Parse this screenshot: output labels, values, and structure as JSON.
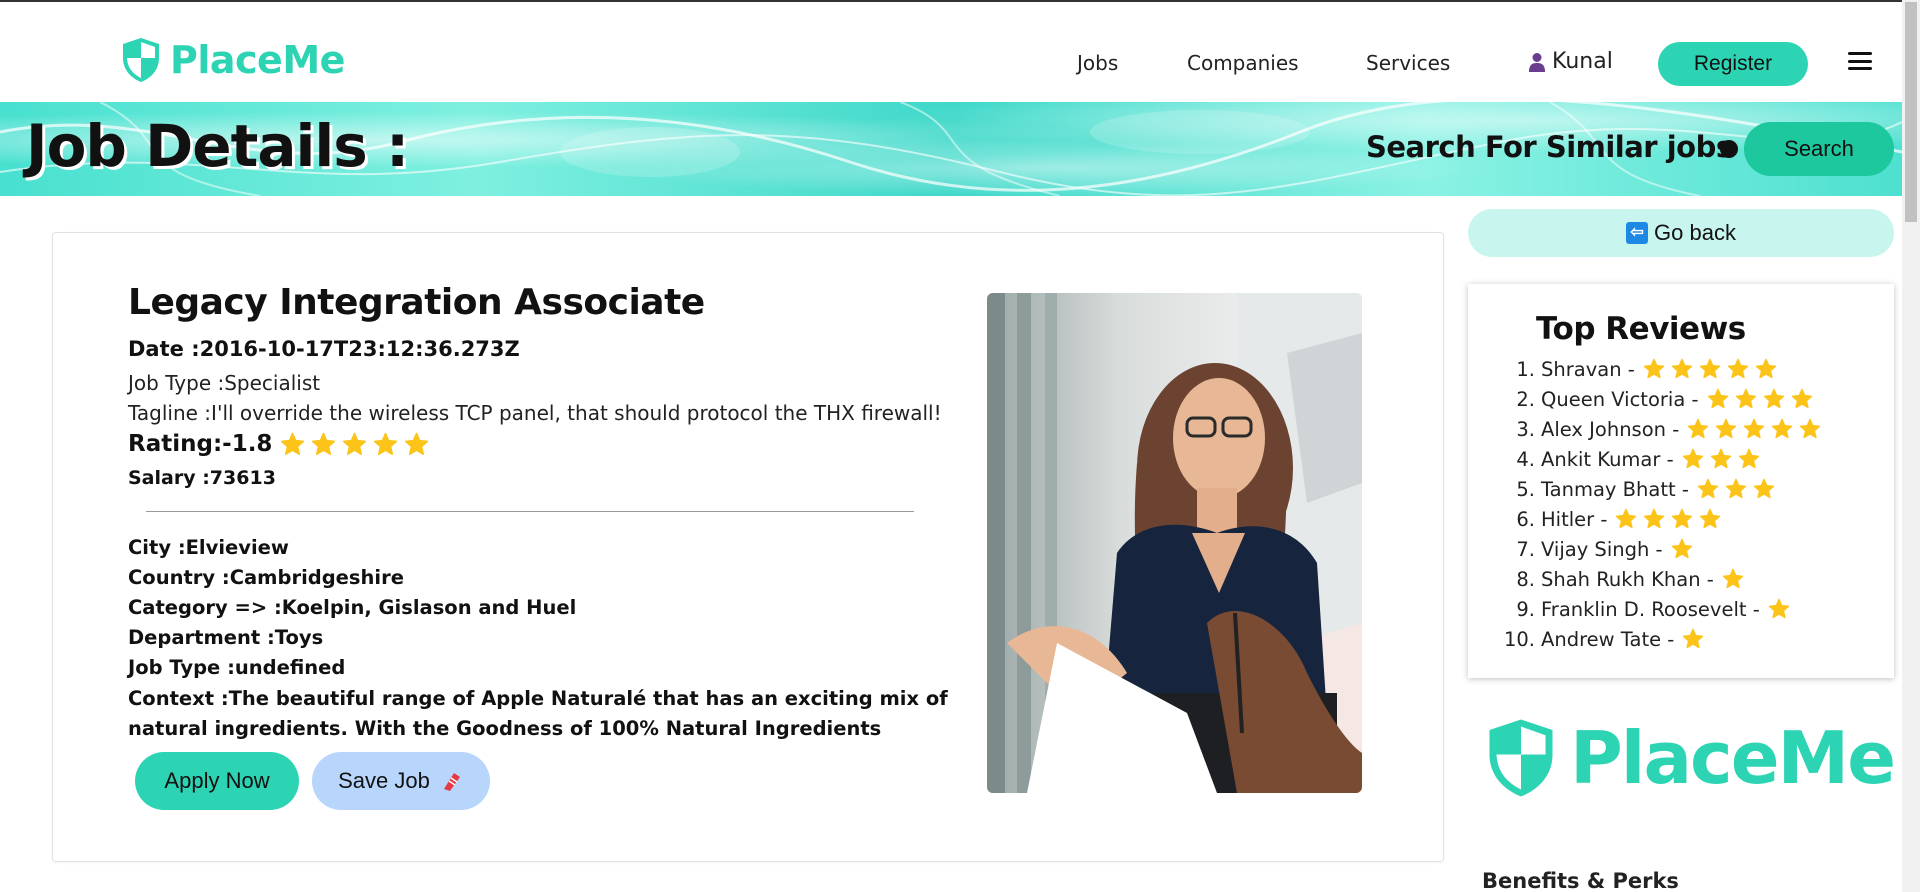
{
  "brand": {
    "name": "PlaceMe",
    "color": "#2dd4b4"
  },
  "nav": {
    "links": [
      "Jobs",
      "Companies",
      "Services"
    ],
    "user": "Kunal",
    "register_label": "Register"
  },
  "hero": {
    "title": "Job Details :",
    "search_label": "Search For Similar jobs",
    "search_button": "Search"
  },
  "job": {
    "title": "Legacy Integration Associate",
    "date": "Date :2016-10-17T23:12:36.273Z",
    "job_type": "Job Type :Specialist",
    "tagline": "Tagline :I'll override the wireless TCP panel, that should protocol the THX firewall!",
    "rating_label": "Rating:-1.8",
    "rating_stars": 5,
    "salary": "Salary :73613",
    "city": "City :Elvieview",
    "country": "Country :Cambridgeshire",
    "category": "Category => :Koelpin, Gislason and Huel",
    "department": "Department :Toys",
    "job_type_2": "Job Type :undefined",
    "context": "Context :The beautiful range of Apple Naturalé that has an exciting mix of natural ingredients. With the Goodness of 100% Natural Ingredients",
    "apply_label": "Apply Now",
    "save_label": "Save Job",
    "photo_icon": "woman-at-desk-photo"
  },
  "sidebar": {
    "go_back_label": "Go back",
    "reviews_title": "Top Reviews",
    "reviews": [
      {
        "num": "1.",
        "name": "Shravan -",
        "stars": 5
      },
      {
        "num": "2.",
        "name": "Queen Victoria -",
        "stars": 4
      },
      {
        "num": "3.",
        "name": "Alex Johnson -",
        "stars": 5
      },
      {
        "num": "4.",
        "name": "Ankit Kumar -",
        "stars": 3
      },
      {
        "num": "5.",
        "name": "Tanmay Bhatt -",
        "stars": 3
      },
      {
        "num": "6.",
        "name": "Hitler -",
        "stars": 4
      },
      {
        "num": "7.",
        "name": "Vijay Singh -",
        "stars": 1
      },
      {
        "num": "8.",
        "name": "Shah Rukh Khan -",
        "stars": 1
      },
      {
        "num": "9.",
        "name": "Franklin D. Roosevelt -",
        "stars": 1
      },
      {
        "num": "10.",
        "name": "Andrew Tate -",
        "stars": 1
      }
    ],
    "logo_name": "PlaceMe",
    "benefits_title": "Benefits & Perks"
  },
  "colors": {
    "accent": "#2dd4b4",
    "star": "#fcc419",
    "save_button": "#b8d6fb",
    "go_back": "#c8f6ee"
  }
}
